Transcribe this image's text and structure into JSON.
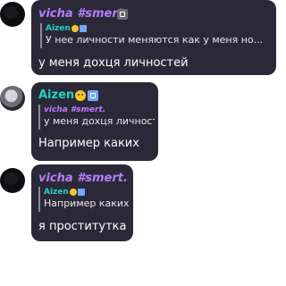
{
  "messages": [
    {
      "author": "vicha #smert.",
      "reply_to": {
        "author": "Aizen",
        "text": "У нее личности меняются как у меня но..."
      },
      "text": "у меня дохця личностей"
    },
    {
      "author": "Aizen",
      "reply_to": {
        "author": "vicha #smert.",
        "text": "у меня дохця личностей"
      },
      "text": "Например каких"
    },
    {
      "author": "vicha #smert.",
      "reply_to": {
        "author": "Aizen",
        "text": "Например каких"
      },
      "text": "я проститутка"
    }
  ]
}
